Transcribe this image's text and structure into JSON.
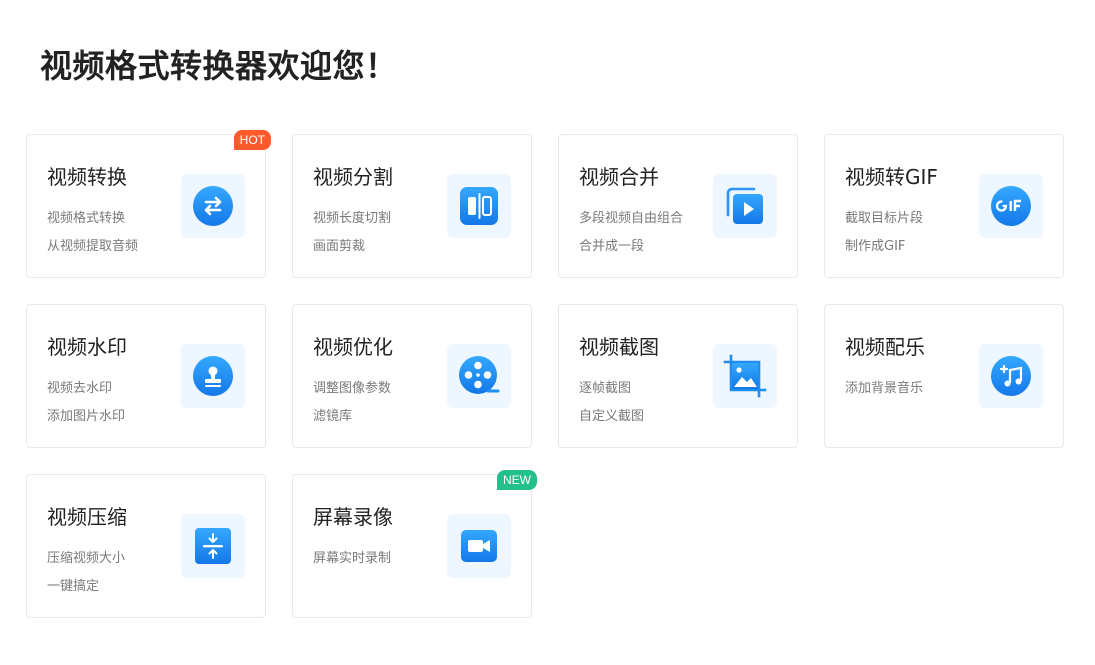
{
  "page": {
    "title": "视频格式转换器欢迎您！"
  },
  "cards": [
    {
      "title": "视频转换",
      "desc1": "视频格式转换",
      "desc2": "从视频提取音频",
      "badge": "HOT",
      "icon": "swap-icon"
    },
    {
      "title": "视频分割",
      "desc1": "视频长度切割",
      "desc2": "画面剪裁",
      "badge": "",
      "icon": "split-icon"
    },
    {
      "title": "视频合并",
      "desc1": "多段视频自由组合",
      "desc2": "合并成一段",
      "badge": "",
      "icon": "merge-play-icon"
    },
    {
      "title": "视频转GIF",
      "desc1": "截取目标片段",
      "desc2": "制作成GIF",
      "badge": "",
      "icon": "gif-icon"
    },
    {
      "title": "视频水印",
      "desc1": "视频去水印",
      "desc2": "添加图片水印",
      "badge": "",
      "icon": "stamp-icon"
    },
    {
      "title": "视频优化",
      "desc1": "调整图像参数",
      "desc2": "滤镜库",
      "badge": "",
      "icon": "film-reel-icon"
    },
    {
      "title": "视频截图",
      "desc1": "逐帧截图",
      "desc2": "自定义截图",
      "badge": "",
      "icon": "crop-image-icon"
    },
    {
      "title": "视频配乐",
      "desc1": "添加背景音乐",
      "desc2": "",
      "badge": "",
      "icon": "music-add-icon"
    },
    {
      "title": "视频压缩",
      "desc1": "压缩视频大小",
      "desc2": "一键搞定",
      "badge": "",
      "icon": "compress-icon"
    },
    {
      "title": "屏幕录像",
      "desc1": "屏幕实时录制",
      "desc2": "",
      "badge": "NEW",
      "icon": "camera-icon"
    }
  ],
  "colors": {
    "accent": "#1f8ef1",
    "icon_bg": "#eef6ff",
    "badge_hot": "#ff5a2c",
    "badge_new": "#22c08a"
  }
}
